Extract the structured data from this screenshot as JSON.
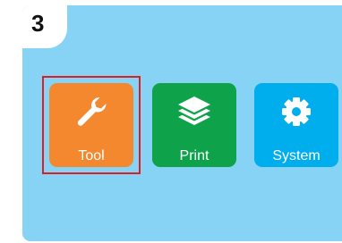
{
  "step": {
    "number": "3"
  },
  "menu": {
    "items": [
      {
        "label": "Tool",
        "icon": "wrench-icon",
        "color": "#f3882f",
        "highlighted": true
      },
      {
        "label": "Print",
        "icon": "layers-icon",
        "color": "#0ea24a",
        "highlighted": false
      },
      {
        "label": "System",
        "icon": "gear-icon",
        "color": "#00aeed",
        "highlighted": false
      }
    ]
  },
  "colors": {
    "screen_background": "#87d3f5",
    "highlight_border": "#dc1f26"
  }
}
